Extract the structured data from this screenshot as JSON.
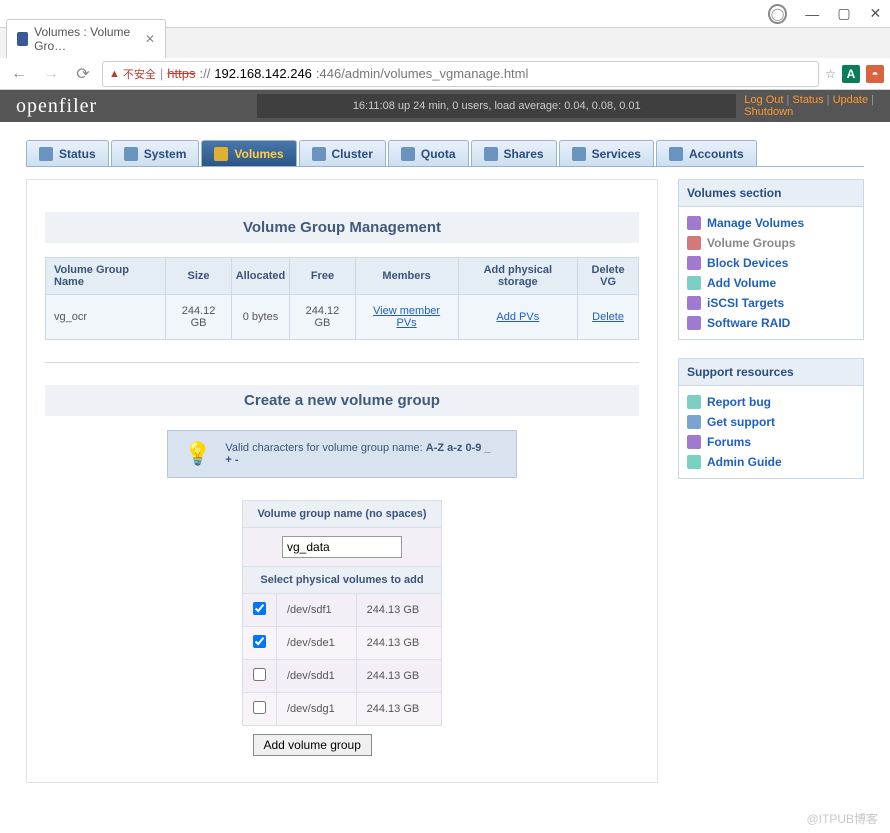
{
  "browser": {
    "tab_title": "Volumes : Volume Gro…",
    "url_scheme": "https",
    "url_host": "192.168.142.246",
    "url_port_path": ":446/admin/volumes_vgmanage.html",
    "insecure_label": "不安全"
  },
  "header": {
    "logo": "openfiler",
    "uptime": "16:11:08 up 24 min, 0 users, load average: 0.04, 0.08, 0.01",
    "links": {
      "logout": "Log Out",
      "status": "Status",
      "update": "Update",
      "shutdown": "Shutdown"
    }
  },
  "nav": [
    {
      "key": "status",
      "label": "Status"
    },
    {
      "key": "system",
      "label": "System"
    },
    {
      "key": "volumes",
      "label": "Volumes"
    },
    {
      "key": "cluster",
      "label": "Cluster"
    },
    {
      "key": "quota",
      "label": "Quota"
    },
    {
      "key": "shares",
      "label": "Shares"
    },
    {
      "key": "services",
      "label": "Services"
    },
    {
      "key": "accounts",
      "label": "Accounts"
    }
  ],
  "nav_active": "volumes",
  "sections": {
    "volumes": {
      "title": "Volumes section",
      "items": [
        {
          "key": "manage",
          "label": "Manage Volumes"
        },
        {
          "key": "vg",
          "label": "Volume Groups",
          "current": true
        },
        {
          "key": "block",
          "label": "Block Devices"
        },
        {
          "key": "add",
          "label": "Add Volume"
        },
        {
          "key": "iscsi",
          "label": "iSCSI Targets"
        },
        {
          "key": "raid",
          "label": "Software RAID"
        }
      ]
    },
    "support": {
      "title": "Support resources",
      "items": [
        {
          "key": "bug",
          "label": "Report bug"
        },
        {
          "key": "sup",
          "label": "Get support"
        },
        {
          "key": "forums",
          "label": "Forums"
        },
        {
          "key": "guide",
          "label": "Admin Guide"
        }
      ]
    }
  },
  "vgm": {
    "heading": "Volume Group Management",
    "columns": [
      "Volume Group Name",
      "Size",
      "Allocated",
      "Free",
      "Members",
      "Add physical storage",
      "Delete VG"
    ],
    "rows": [
      {
        "name": "vg_ocr",
        "size": "244.12 GB",
        "alloc": "0 bytes",
        "free": "244.12 GB",
        "members": "View member PVs",
        "add": "Add PVs",
        "del": "Delete"
      }
    ]
  },
  "create": {
    "heading": "Create a new volume group",
    "hint_prefix": "Valid characters for volume group name: ",
    "hint_chars": "A-Z a-z 0-9 _ + -",
    "name_label": "Volume group name (no spaces)",
    "name_value": "vg_data",
    "pv_label": "Select physical volumes to add",
    "pvs": [
      {
        "dev": "/dev/sdf1",
        "size": "244.13 GB",
        "checked": true
      },
      {
        "dev": "/dev/sde1",
        "size": "244.13 GB",
        "checked": true
      },
      {
        "dev": "/dev/sdd1",
        "size": "244.13 GB",
        "checked": false
      },
      {
        "dev": "/dev/sdg1",
        "size": "244.13 GB",
        "checked": false
      }
    ],
    "submit": "Add volume group"
  },
  "watermark": "@ITPUB博客"
}
